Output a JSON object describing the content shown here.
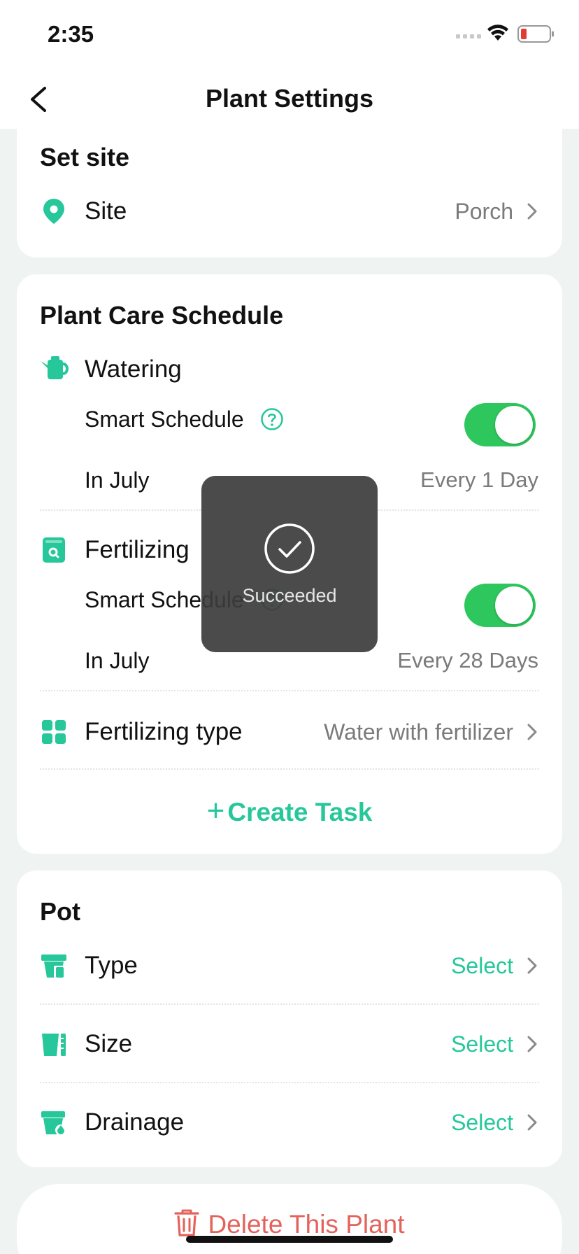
{
  "status": {
    "time": "2:35"
  },
  "nav": {
    "title": "Plant Settings"
  },
  "site_section": {
    "title": "Set site",
    "site_label": "Site",
    "site_value": "Porch"
  },
  "care_section": {
    "title": "Plant Care Schedule",
    "watering": {
      "label": "Watering",
      "smart_label": "Smart Schedule",
      "smart_enabled": true,
      "month_label": "In July",
      "frequency": "Every 1 Day"
    },
    "fertilizing": {
      "label": "Fertilizing",
      "smart_label": "Smart Schedule",
      "smart_enabled": true,
      "month_label": "In July",
      "frequency": "Every 28 Days"
    },
    "fertilizing_type": {
      "label": "Fertilizing type",
      "value": "Water with fertilizer"
    },
    "create_task": {
      "plus": "+",
      "label": "Create Task"
    }
  },
  "pot_section": {
    "title": "Pot",
    "rows": [
      {
        "label": "Type",
        "value": "Select"
      },
      {
        "label": "Size",
        "value": "Select"
      },
      {
        "label": "Drainage",
        "value": "Select"
      }
    ]
  },
  "delete": {
    "label": "Delete This Plant"
  },
  "toast": {
    "text": "Succeeded"
  },
  "colors": {
    "accent": "#26c79a",
    "toggle_on": "#2dc75d",
    "danger": "#e4625c",
    "background": "#eff3f2"
  },
  "icons": {
    "site": "location-pin-icon",
    "watering": "watering-can-icon",
    "fertilizing": "fertilizer-bag-icon",
    "fertilizing_type": "grid-icon",
    "pot_type": "pot-icon",
    "pot_size": "pot-ruler-icon",
    "pot_drainage": "pot-drop-icon"
  }
}
